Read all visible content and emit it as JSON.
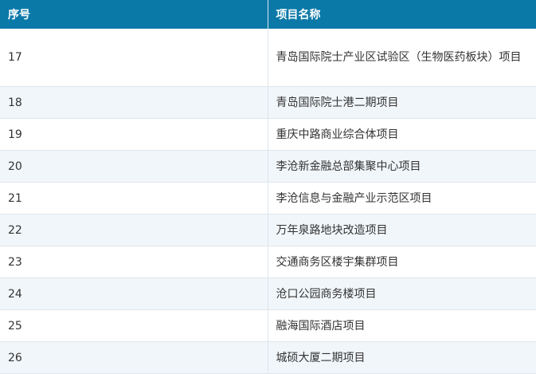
{
  "table": {
    "headers": [
      "序号",
      "项目名称"
    ],
    "rows": [
      {
        "no": "17",
        "name": "青岛国际院士产业区试验区（生物医药板块）项目"
      },
      {
        "no": "18",
        "name": "青岛国际院士港二期项目"
      },
      {
        "no": "19",
        "name": "重庆中路商业综合体项目"
      },
      {
        "no": "20",
        "name": "李沧新金融总部集聚中心项目"
      },
      {
        "no": "21",
        "name": "李沧信息与金融产业示范区项目"
      },
      {
        "no": "22",
        "name": "万年泉路地块改造项目"
      },
      {
        "no": "23",
        "name": "交通商务区楼宇集群项目"
      },
      {
        "no": "24",
        "name": "沧口公园商务楼项目"
      },
      {
        "no": "25",
        "name": "融海国际酒店项目"
      },
      {
        "no": "26",
        "name": "城硕大厦二期项目"
      }
    ]
  },
  "colors": {
    "header_bg": "#0b79a8",
    "header_text": "#ffffff",
    "stripe_bg": "#f1f6fa",
    "border": "#dde6ec",
    "text": "#333333"
  }
}
